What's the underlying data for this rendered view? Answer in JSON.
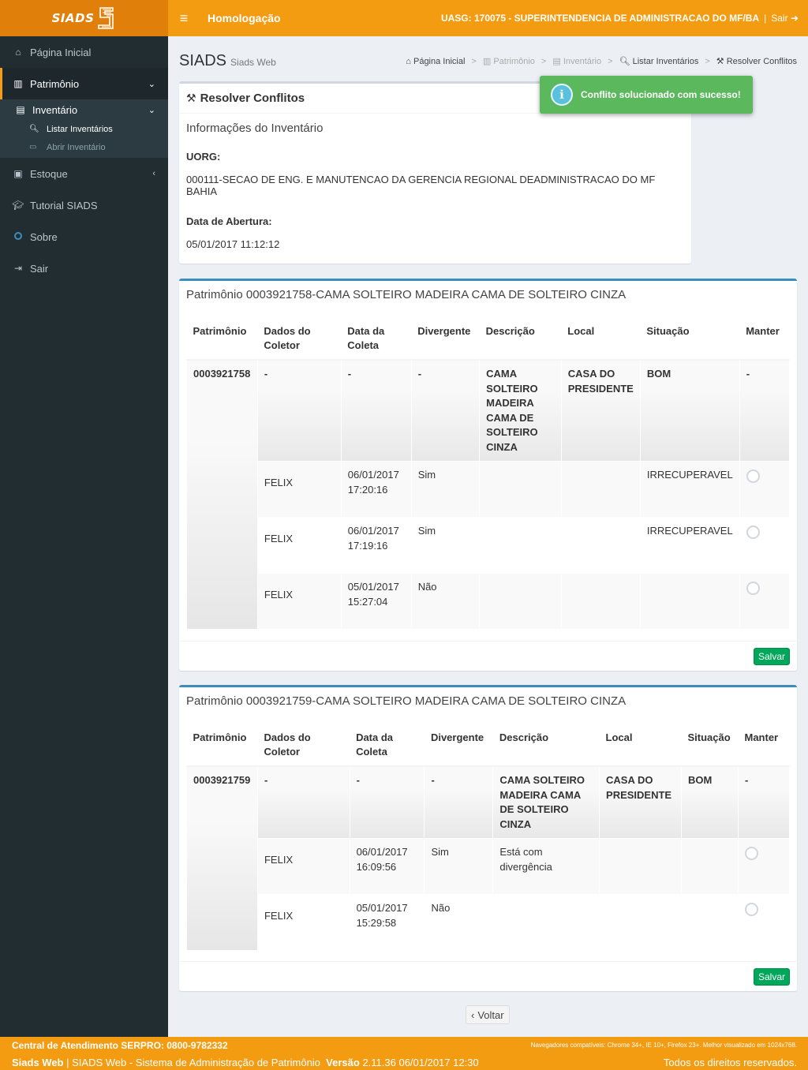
{
  "header": {
    "logo_text": "SIADS",
    "environment": "Homologação",
    "uasg": "UASG: 170075 - SUPERINTENDENCIA DE ADMINISTRACAO DO MF/BA",
    "separator": "|",
    "logout": "Sair"
  },
  "sidebar": {
    "home": "Página Inicial",
    "patrimonio": "Patrimônio",
    "inventario": "Inventário",
    "listar": "Listar Inventários",
    "abrir": "Abrir Inventário",
    "estoque": "Estoque",
    "tutorial": "Tutorial SIADS",
    "sobre": "Sobre",
    "sair": "Sair"
  },
  "page": {
    "title": "SIADS",
    "subtitle": "Siads Web"
  },
  "breadcrumb": {
    "home": "Página Inicial",
    "patrimonio": "Patrimônio",
    "inventario": "Inventário",
    "listar": "Listar Inventários",
    "current": "Resolver Conflitos",
    "sep": ">"
  },
  "toast": {
    "message": "Conflito solucionado com sucesso!"
  },
  "info": {
    "box_title": "Resolver Conflitos",
    "heading": "Informações do Inventário",
    "uorg_label": "UORG:",
    "uorg_value": "000111-SECAO DE ENG. E MANUTENCAO DA GERENCIA REGIONAL DEADMINISTRACAO DO MF BAHIA",
    "date_label": "Data de Abertura:",
    "date_value": "05/01/2017 11:12:12"
  },
  "table_headers": {
    "patrimonio": "Patrimônio",
    "dados": "Dados do Coletor",
    "data": "Data da Coleta",
    "divergente": "Divergente",
    "descricao": "Descrição",
    "local": "Local",
    "situacao": "Situação",
    "manter": "Manter"
  },
  "patrimonio1": {
    "title": "Patrimônio 0003921758-CAMA SOLTEIRO MADEIRA CAMA DE SOLTEIRO CINZA",
    "number": "0003921758",
    "main": {
      "dados": "-",
      "data": "-",
      "divergente": "-",
      "descricao": "CAMA SOLTEIRO MADEIRA CAMA DE SOLTEIRO CINZA",
      "local": "CASA DO PRESIDENTE",
      "situacao": "BOM",
      "manter": "-"
    },
    "rows": [
      {
        "coletor": "FELIX",
        "data": "06/01/2017 17:20:16",
        "divergente": "Sim",
        "descricao": "",
        "local": "",
        "situacao": "IRRECUPERAVEL"
      },
      {
        "coletor": "FELIX",
        "data": "06/01/2017 17:19:16",
        "divergente": "Sim",
        "descricao": "",
        "local": "",
        "situacao": "IRRECUPERAVEL"
      },
      {
        "coletor": "FELIX",
        "data": "05/01/2017 15:27:04",
        "divergente": "Não",
        "descricao": "",
        "local": "",
        "situacao": ""
      }
    ],
    "save": "Salvar"
  },
  "patrimonio2": {
    "title": "Patrimônio 0003921759-CAMA SOLTEIRO MADEIRA CAMA DE SOLTEIRO CINZA",
    "number": "0003921759",
    "main": {
      "dados": "-",
      "data": "-",
      "divergente": "-",
      "descricao": "CAMA SOLTEIRO MADEIRA CAMA DE SOLTEIRO CINZA",
      "local": "CASA DO PRESIDENTE",
      "situacao": "BOM",
      "manter": "-"
    },
    "rows": [
      {
        "coletor": "FELIX",
        "data": "06/01/2017 16:09:56",
        "divergente": "Sim",
        "descricao": "Está com divergência",
        "local": "",
        "situacao": ""
      },
      {
        "coletor": "FELIX",
        "data": "05/01/2017 15:29:58",
        "divergente": "Não",
        "descricao": "",
        "local": "",
        "situacao": ""
      }
    ],
    "save": "Salvar"
  },
  "back_button": "Voltar",
  "footer": {
    "support": "Central de Atendimento SERPRO: 0800-9782332",
    "browsers": "Navegadores compatíveis: Chrome 34+, IE 10+, Firefox 23+. Melhor visualizado em 1024x768.",
    "app_name": "Siads Web",
    "app_desc": "| SIADS Web - Sistema de Administração de Patrimônio",
    "version_label": "Versão",
    "version_value": "2.11.36 06/01/2017 12:30",
    "rights": "Todos os direitos reservados."
  },
  "colors": {
    "header_orange": "#f39c12",
    "logo_orange": "#e0800a",
    "sidebar_dark": "#222d32",
    "box_blue": "#3c8dbc",
    "save_green": "#00a65a",
    "toast_green": "#5cb85c"
  }
}
